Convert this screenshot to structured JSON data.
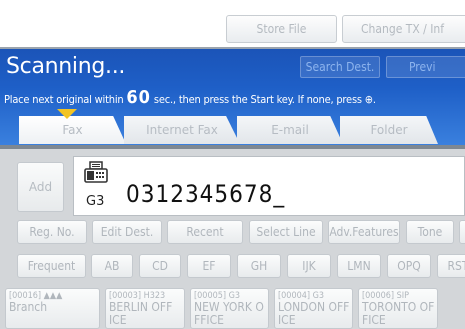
{
  "toolbar": {
    "store_file": "Store File",
    "change_tx": "Change TX / Inf"
  },
  "status": {
    "title": "Scanning...",
    "search_dest": "Search Dest.",
    "preview": "Previ",
    "msg_before": "Place next original within",
    "msg_seconds": "60",
    "msg_after": "sec., then press the Start key. If none, press ⊕."
  },
  "tabs": [
    "Fax",
    "Internet Fax",
    "E-mail",
    "Folder"
  ],
  "destination": {
    "add_label": "Add",
    "line": "G3",
    "number": "0312345678_"
  },
  "function_buttons": [
    "Reg. No.",
    "Edit Dest.",
    "Recent",
    "Select Line",
    "Adv.Features",
    "Tone",
    ""
  ],
  "index_tabs": [
    "Frequent",
    "AB",
    "CD",
    "EF",
    "GH",
    "IJK",
    "LMN",
    "OPQ",
    "RST"
  ],
  "entries": [
    {
      "code": "[00016] ▲▲▲",
      "name": "Branch"
    },
    {
      "code": "[00003] H323",
      "name": "BERLIN OFF",
      "name2": "ICE"
    },
    {
      "code": "[00005] G3",
      "name": "NEW YORK O",
      "name2": "FFICE"
    },
    {
      "code": "[00004] G3",
      "name": "LONDON OFF",
      "name2": "ICE"
    },
    {
      "code": "[00006] SIP",
      "name": "TORONTO OF",
      "name2": "FICE"
    }
  ],
  "colors": {
    "status_blue": "#1e5fc7",
    "panel_grey": "#d3d6d9",
    "arrow_yellow": "#f2c424"
  }
}
